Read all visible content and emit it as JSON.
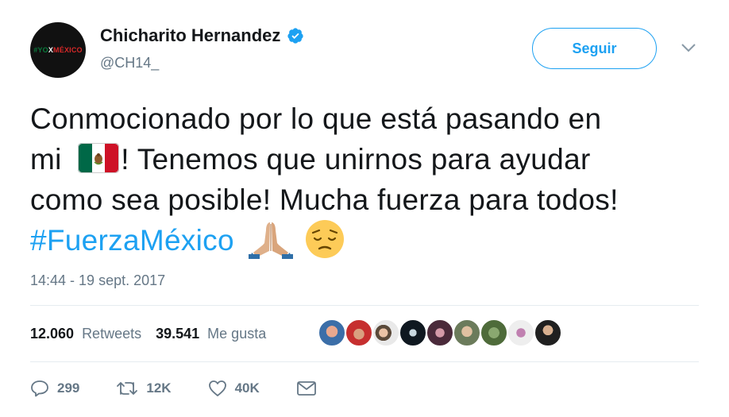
{
  "user": {
    "name": "Chicharito Hernandez",
    "handle": "@CH14_",
    "avatar_text": "#YOXMÉXICO",
    "verified": true
  },
  "follow_button": {
    "label": "Seguir"
  },
  "tweet": {
    "lines": [
      "Conmocionado por lo que está pasando en",
      "mi",
      "! Tenemos que unirnos para ayudar",
      "como sea posible! Mucha fuerza para todos!"
    ],
    "hashtag": "#FuerzaMéxico",
    "emojis": [
      "mexico-flag",
      "folded-hands",
      "pensive-face"
    ]
  },
  "timestamp": "14:44 - 19 sept. 2017",
  "stats": {
    "retweets_count": "12.060",
    "retweets_label": "Retweets",
    "likes_count": "39.541",
    "likes_label": "Me gusta"
  },
  "actions": {
    "replies": "299",
    "retweets": "12K",
    "likes": "40K"
  },
  "colors": {
    "accent": "#1da1f2",
    "secondary_text": "#657786",
    "divider": "#e6ecf0"
  }
}
